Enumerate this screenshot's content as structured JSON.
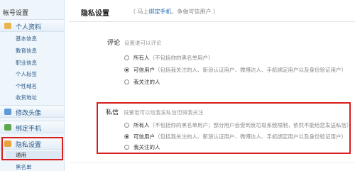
{
  "sidebar": {
    "title": "帐号设置",
    "sections": [
      {
        "label": "个人资料",
        "icon": "person-icon"
      },
      {
        "label": "修改头像",
        "icon": "avatar-icon"
      },
      {
        "label": "绑定手机",
        "icon": "phone-icon"
      },
      {
        "label": "隐私设置",
        "icon": "lock-icon"
      }
    ],
    "profile_items": [
      "基本信息",
      "教育信息",
      "职业信息",
      "个人标签",
      "个性域名",
      "收货地址"
    ],
    "privacy_items": [
      "通用",
      "黑名单"
    ]
  },
  "main": {
    "title": "隐私设置",
    "subtitle_prefix": "（ 马上",
    "subtitle_link": "绑定手机",
    "subtitle_suffix": "，争做可信用户 ）",
    "comment": {
      "label": "评论",
      "hint": "设置谁可以评论",
      "options": [
        {
          "name": "所有人",
          "note": "（不包括你的黑名单用户）",
          "checked": false
        },
        {
          "name": "可信用户",
          "note": "（包括我关注的人、新浪认证用户、微博达人、手机绑定用户以及身份验证用户）",
          "checked": true
        },
        {
          "name": "我关注的人",
          "note": "",
          "checked": false
        }
      ]
    },
    "message": {
      "label": "私信",
      "hint": "设置谁可以给我发私信但得我关注",
      "options": [
        {
          "name": "所有人",
          "note": "（不包括你的黑名单用户；部分用户会受到反垃圾系统限制，依然不能给您发送私信）",
          "checked": false
        },
        {
          "name": "可信用户",
          "note": "（包括我关注的人、新浪认证用户、微博达人、手机绑定用户以及身份验证用户）",
          "checked": true
        },
        {
          "name": "我关注的人",
          "note": "",
          "checked": false
        }
      ]
    }
  },
  "colors": {
    "highlight": "#d81e1e",
    "link": "#2a6fb5",
    "sidebar_bg": "#eef5fb"
  }
}
